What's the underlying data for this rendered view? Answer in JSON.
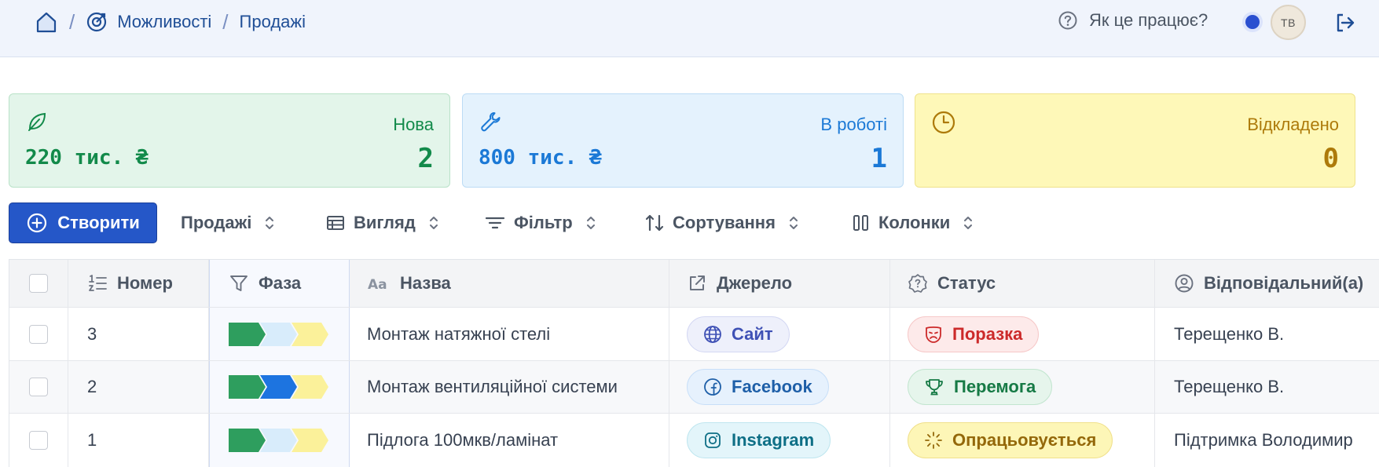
{
  "breadcrumb": {
    "section": "Можливості",
    "page": "Продажі"
  },
  "header": {
    "help_label": "Як це працює?",
    "avatar_initials": "ТВ"
  },
  "stats": [
    {
      "label": "Нова",
      "amount": "220 тис. ₴",
      "count": "2",
      "icon": "leaf-icon",
      "color": "#128a4a"
    },
    {
      "label": "В роботі",
      "amount": "800 тис. ₴",
      "count": "1",
      "icon": "wrench-icon",
      "color": "#1b79d6"
    },
    {
      "label": "Відкладено",
      "amount": "",
      "count": "0",
      "icon": "clock-icon",
      "color": "#ad7a0a"
    }
  ],
  "toolbar": {
    "create_label": "Створити",
    "pipeline_label": "Продажі",
    "view_label": "Вигляд",
    "filter_label": "Фільтр",
    "sort_label": "Сортування",
    "columns_label": "Колонки"
  },
  "table": {
    "columns": [
      "Номер",
      "Фаза",
      "Назва",
      "Джерело",
      "Статус",
      "Відповідальний(а)"
    ],
    "rows": [
      {
        "number": "3",
        "phase": "Нова",
        "name": "Монтаж натяжної стелі",
        "source": "Сайт",
        "source_icon": "globe-icon",
        "status": "Поразка",
        "status_icon": "sad-mask-icon",
        "owner": "Терещенко В."
      },
      {
        "number": "2",
        "phase": "В роботі",
        "name": "Монтаж вентиляційної системи",
        "source": "Facebook",
        "source_icon": "facebook-icon",
        "status": "Перемога",
        "status_icon": "trophy-icon",
        "owner": "Терещенко В."
      },
      {
        "number": "1",
        "phase": "Нова",
        "name": "Підлога 100мкв/ламінат",
        "source": "Instagram",
        "source_icon": "instagram-icon",
        "status": "Опрацьовується",
        "status_icon": "loader-icon",
        "owner": "Підтримка Володимир"
      }
    ]
  },
  "colors": {
    "primary": "#2557c8",
    "phase_done": "#2e9e5e",
    "phase_active": "#1d74e0",
    "phase_pending": "#d8ecfb",
    "phase_last": "#fbf19a"
  }
}
